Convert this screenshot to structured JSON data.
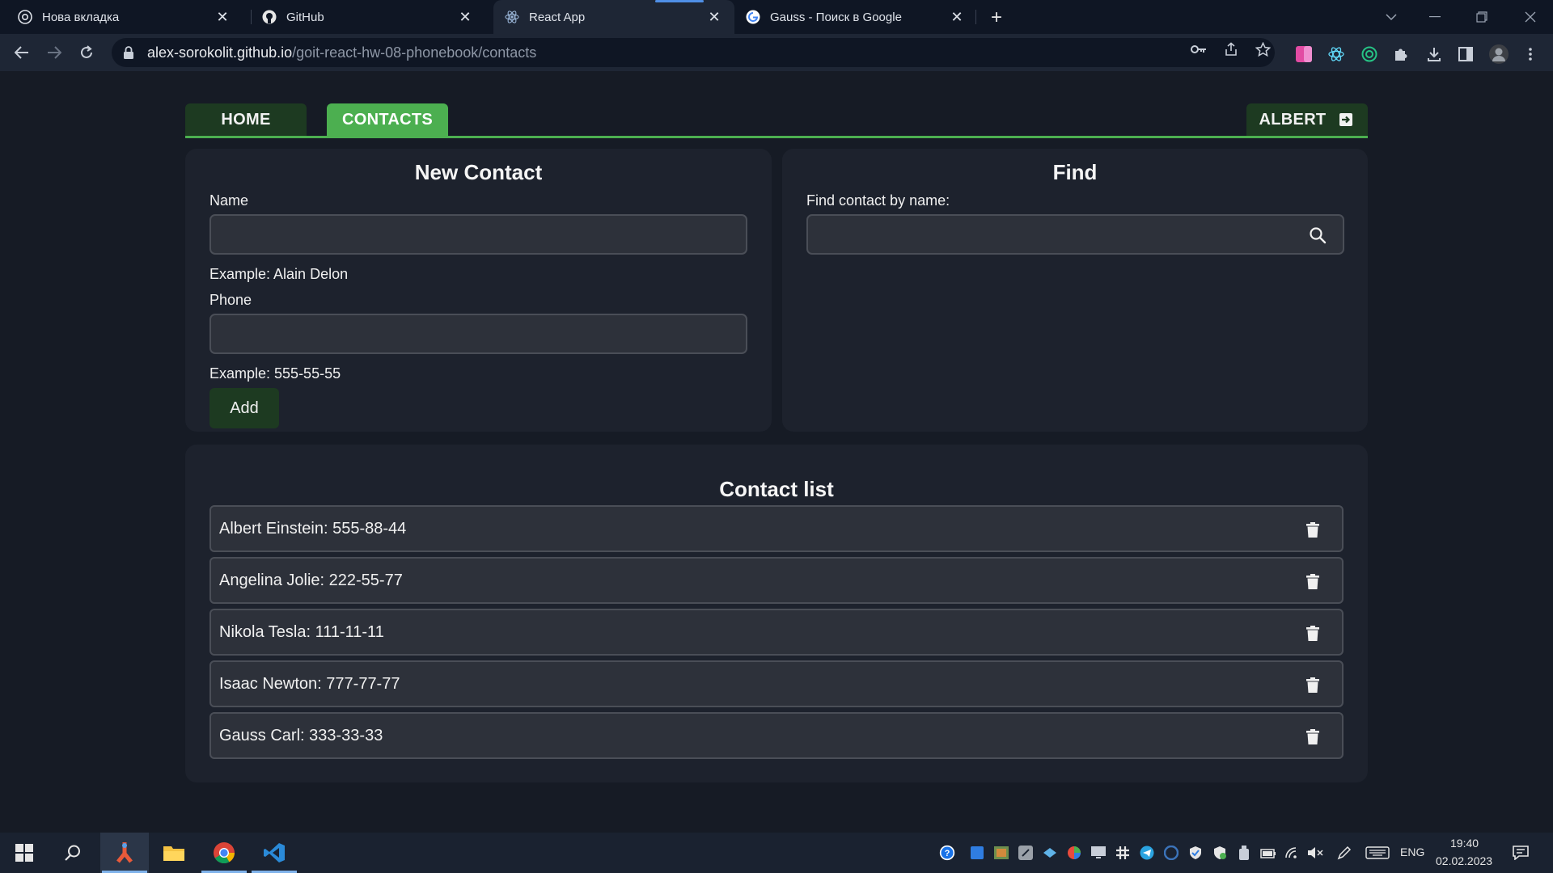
{
  "browser": {
    "tabs": [
      {
        "title": "Нова вкладка",
        "icon": "chrome-newtab-icon",
        "active": false
      },
      {
        "title": "GitHub",
        "icon": "github-icon",
        "active": false
      },
      {
        "title": "React App",
        "icon": "react-icon",
        "active": true
      },
      {
        "title": "Gauss - Поиск в Google",
        "icon": "google-icon",
        "active": false
      }
    ],
    "url_host": "alex-sorokolit.github.io",
    "url_path": "/goit-react-hw-08-phonebook/contacts"
  },
  "nav": {
    "home": "HOME",
    "contacts": "CONTACTS",
    "user": "ALBERT"
  },
  "new_contact": {
    "title": "New Contact",
    "name_label": "Name",
    "name_value": "",
    "name_hint": "Example: Alain Delon",
    "phone_label": "Phone",
    "phone_value": "",
    "phone_hint": "Example: 555-55-55",
    "add_label": "Add"
  },
  "find": {
    "title": "Find",
    "label": "Find contact by name:",
    "value": ""
  },
  "contact_list": {
    "title": "Contact list",
    "items": [
      "Albert Einstein: 555-88-44",
      "Angelina Jolie: 222-55-77",
      "Nikola Tesla: 111-11-11",
      "Isaac Newton: 777-77-77",
      "Gauss Carl: 333-33-33"
    ]
  },
  "taskbar": {
    "language": "ENG",
    "time": "19:40",
    "date": "02.02.2023"
  },
  "colors": {
    "accent_green": "#4caf50",
    "dark_green": "#1d3a21",
    "page_bg": "#161b25",
    "panel_bg": "#1d222d",
    "input_bg": "#2d313a"
  }
}
